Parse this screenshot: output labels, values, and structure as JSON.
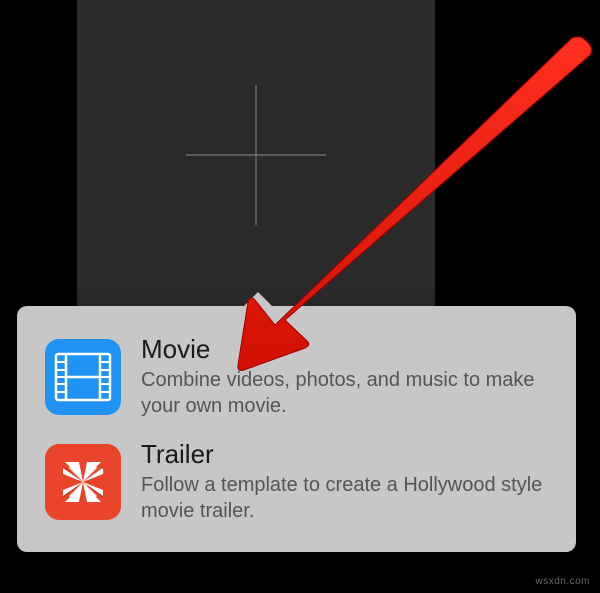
{
  "create_tile": {
    "icon": "plus-icon"
  },
  "popover": {
    "items": [
      {
        "icon": "film-strip-icon",
        "title": "Movie",
        "description": "Combine videos, photos, and music to make your own movie."
      },
      {
        "icon": "clapperboard-icon",
        "title": "Trailer",
        "description": "Follow a template to create a Hollywood style movie trailer."
      }
    ]
  },
  "annotation": {
    "type": "arrow",
    "color": "#ff0000",
    "target": "movie-option"
  },
  "watermark": "wsxdn.com"
}
